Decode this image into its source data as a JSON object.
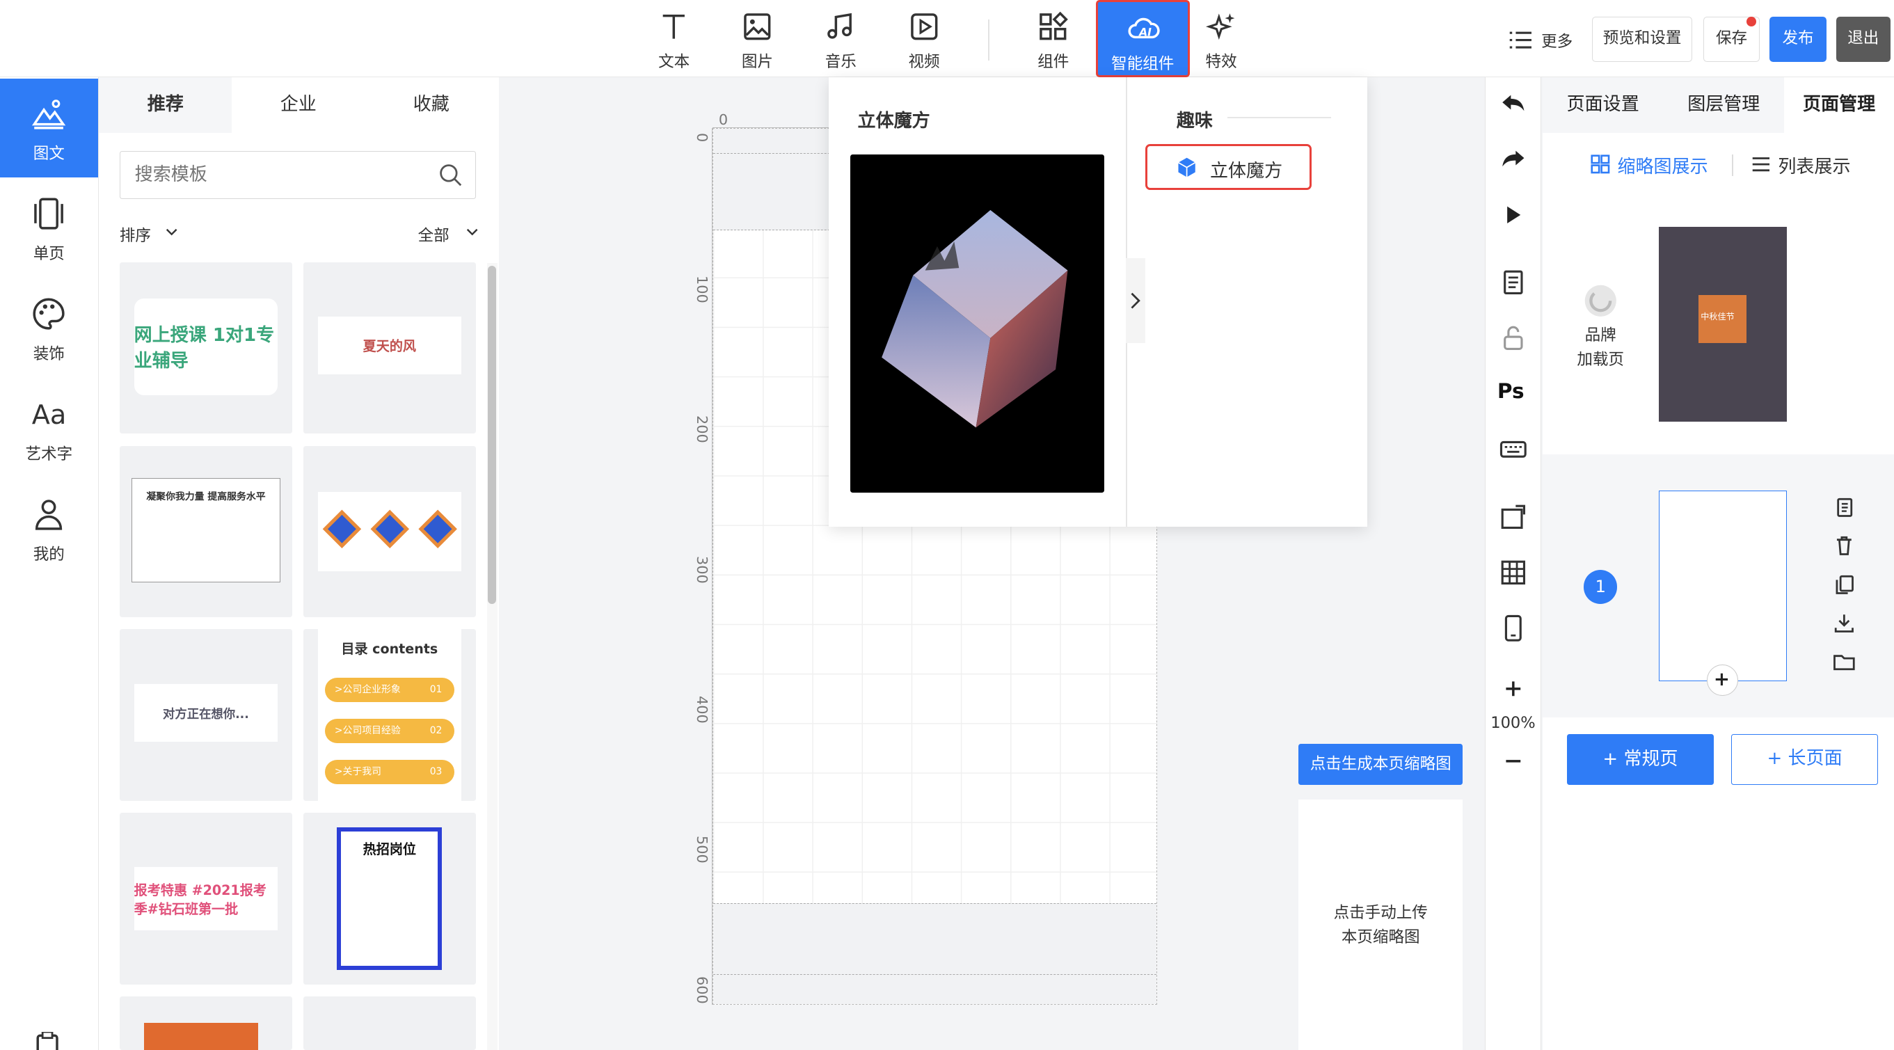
{
  "toolbar": {
    "tools": [
      {
        "label": "文本",
        "icon": "text-icon"
      },
      {
        "label": "图片",
        "icon": "image-icon"
      },
      {
        "label": "音乐",
        "icon": "music-icon"
      },
      {
        "label": "视频",
        "icon": "video-icon"
      },
      {
        "label": "组件",
        "icon": "components-icon"
      },
      {
        "label": "智能组件",
        "icon": "ai-cloud-icon"
      },
      {
        "label": "特效",
        "icon": "sparkle-icon"
      }
    ],
    "more_label": "更多",
    "preview_label": "预览和设置",
    "save_label": "保存",
    "publish_label": "发布",
    "exit_label": "退出"
  },
  "left_nav": [
    {
      "label": "图文",
      "icon": "mountain-icon"
    },
    {
      "label": "单页",
      "icon": "single-page-icon"
    },
    {
      "label": "装饰",
      "icon": "palette-icon"
    },
    {
      "label": "艺术字",
      "icon": "art-text-icon"
    },
    {
      "label": "我的",
      "icon": "user-icon"
    }
  ],
  "templates": {
    "tabs": [
      "推荐",
      "企业",
      "收藏"
    ],
    "search_placeholder": "搜索模板",
    "sort_label": "排序",
    "filter_label": "全部",
    "items": [
      {
        "text": "网上授课 1对1专业辅导"
      },
      {
        "text": "夏天的风"
      },
      {
        "text": "凝聚你我力量 提高服务水平"
      },
      {
        "text": "01 02 03"
      },
      {
        "text": "对方正在想你..."
      },
      {
        "text": "目录 contents"
      },
      {
        "text": "报考特惠 #2021报考季#钻石班第一批"
      },
      {
        "text": "热招岗位"
      }
    ],
    "toc_items": [
      ">公司企业形象",
      ">公司项目经验",
      ">关于我司"
    ],
    "toc_nums": [
      "01",
      "02",
      "03"
    ]
  },
  "canvas": {
    "ruler_h_zero": "0",
    "ruler_v": [
      "0",
      "100",
      "200",
      "300",
      "400",
      "500",
      "600"
    ]
  },
  "smart_popup": {
    "preview_title": "立体魔方",
    "category_title": "趣味",
    "item_label": "立体魔方"
  },
  "right_tools": {
    "zoom": "100%",
    "ps_label": "Ps"
  },
  "right_panel": {
    "tabs": [
      "页面设置",
      "图层管理",
      "页面管理"
    ],
    "view_thumb_label": "缩略图展示",
    "view_list_label": "列表展示",
    "brand_label": "品牌\n加载页",
    "brand_thumb_text": "中秋佳节",
    "page_number": "1",
    "add_normal_label": "+ 常规页",
    "add_long_label": "+ 长页面",
    "gen_thumb_label": "点击生成本页缩略图",
    "upload_thumb_label": "点击手动上传\n本页缩略图"
  },
  "colors": {
    "accent": "#2f7cf6",
    "highlight_border": "#e8413b",
    "exit_bg": "#5a5a5a"
  }
}
